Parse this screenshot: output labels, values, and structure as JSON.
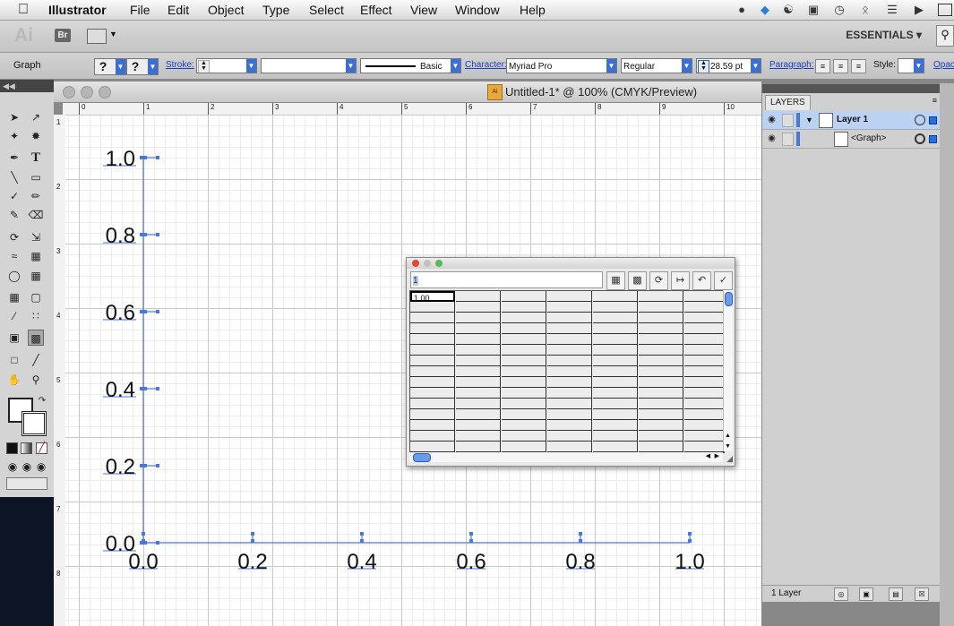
{
  "menubar": {
    "apple": "",
    "app_name": "Illustrator",
    "items": [
      "File",
      "Edit",
      "Object",
      "Type",
      "Select",
      "Effect",
      "View",
      "Window",
      "Help"
    ],
    "status_icons": [
      "evernote-icon",
      "dropbox-icon",
      "network-icon",
      "display-icon",
      "time-machine-icon",
      "bluetooth-icon",
      "wifi-icon",
      "volume-icon",
      "input-icon"
    ]
  },
  "appbar": {
    "logo": "Ai",
    "bridge": "Br",
    "workspace": "ESSENTIALS ▾"
  },
  "control_bar": {
    "selection_label": "Graph",
    "fill_glyph": "?",
    "stroke_glyph": "?",
    "stroke_label": "Stroke:",
    "brush_label": "Basic",
    "character_label": "Character:",
    "font_family": "Myriad Pro",
    "font_style": "Regular",
    "font_size": "28.59 pt",
    "paragraph_label": "Paragraph:",
    "style_label": "Style:",
    "opacity_label": "Opac"
  },
  "document": {
    "title": "Untitled-1* @ 100% (CMYK/Preview)",
    "ai_icon_text": "Ai"
  },
  "rulers": {
    "horizontal": [
      "0",
      "1",
      "2",
      "3",
      "4",
      "5",
      "6",
      "7",
      "8",
      "9",
      "10"
    ],
    "vertical": [
      "1",
      "2",
      "3",
      "4",
      "5",
      "6",
      "7",
      "8"
    ]
  },
  "layers_panel": {
    "tab": "LAYERS",
    "rows": [
      {
        "name": "Layer 1"
      },
      {
        "name": "<Graph>"
      }
    ],
    "footer": "1 Layer"
  },
  "graph_data": {
    "entry": "1",
    "selected_cell": "1.00",
    "buttons": [
      "import-data",
      "transpose",
      "switch-xy",
      "cell-style",
      "revert",
      "apply"
    ]
  },
  "colors": {
    "selection_blue": "#4a78d8",
    "axis_label": "#111111"
  },
  "chart_data": {
    "type": "bar",
    "categories": [],
    "values": [
      1
    ],
    "xlim": [
      0.0,
      1.0
    ],
    "ylim": [
      0.0,
      1.0
    ],
    "x_tick_labels": [
      "0.0",
      "0.2",
      "0.4",
      "0.6",
      "0.8",
      "1.0"
    ],
    "y_tick_labels": [
      "0.0",
      "0.2",
      "0.4",
      "0.6",
      "0.8",
      "1.0"
    ],
    "grid": false
  }
}
